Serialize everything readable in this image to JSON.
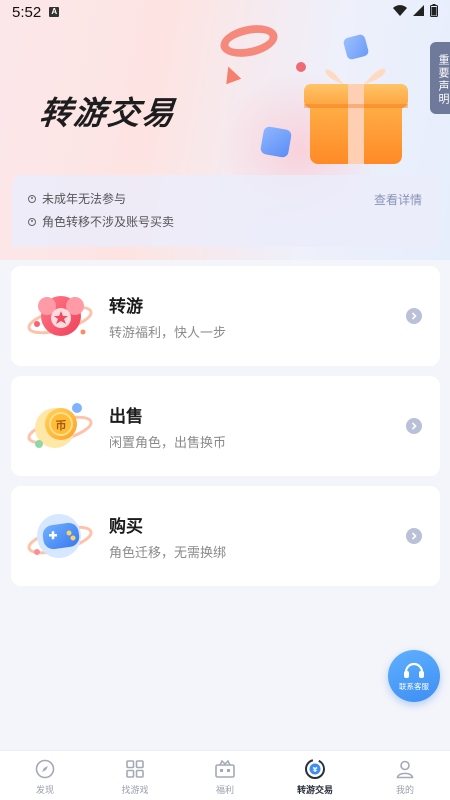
{
  "status_bar": {
    "time": "5:52",
    "notification_letter": "A"
  },
  "hero": {
    "title": "转游交易",
    "side_tab_label": "重要声明"
  },
  "notice": {
    "items": [
      "未成年无法参与",
      "角色转移不涉及账号买卖"
    ],
    "detail_link": "查看详情"
  },
  "cards": [
    {
      "title": "转游",
      "subtitle": "转游福利，快人一步",
      "icon": "star-badge-icon"
    },
    {
      "title": "出售",
      "subtitle": "闲置角色，出售换币",
      "icon": "coin-icon"
    },
    {
      "title": "购买",
      "subtitle": "角色迁移，无需换绑",
      "icon": "gamepad-icon"
    }
  ],
  "support_button": {
    "label": "联系客服"
  },
  "tabbar": [
    {
      "label": "发现",
      "icon": "compass-icon",
      "active": false
    },
    {
      "label": "找游戏",
      "icon": "grid-icon",
      "active": false
    },
    {
      "label": "福利",
      "icon": "gift-box-icon",
      "active": false
    },
    {
      "label": "转游交易",
      "icon": "exchange-icon",
      "active": true
    },
    {
      "label": "我的",
      "icon": "user-icon",
      "active": false
    }
  ],
  "colors": {
    "accent_blue": "#3d8ef4",
    "active_tab": "#2a2f3d",
    "inactive_tab": "#9a9fae"
  }
}
